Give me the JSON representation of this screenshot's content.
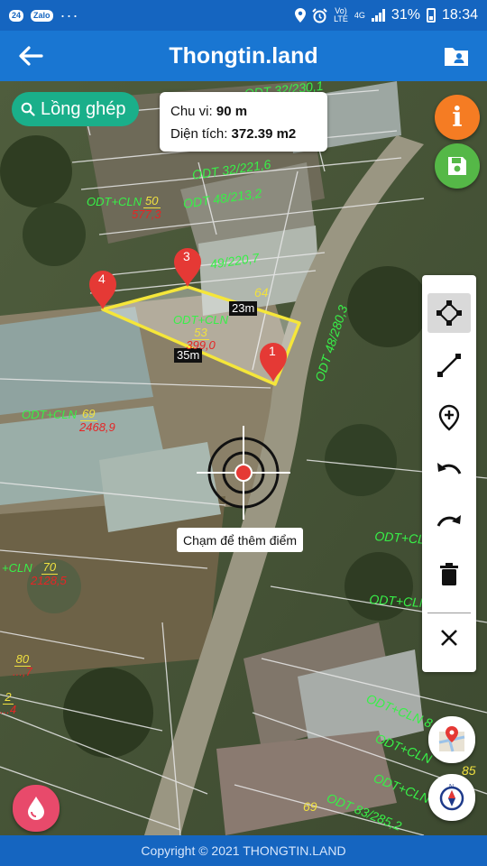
{
  "status_bar": {
    "time": "18:34",
    "battery": "31%",
    "network_top": "Vo)",
    "network_bottom": "LTE",
    "net_gen": "4G",
    "app_chip_1": "24",
    "app_chip_2": "Zalo",
    "more": "···"
  },
  "header": {
    "title": "Thongtin.land"
  },
  "search_chip": {
    "label": "Lồng ghép"
  },
  "info_card": {
    "perimeter_label": "Chu vi:",
    "perimeter_value": "90 m",
    "area_label": "Diện tích:",
    "area_value": "372.39 m2"
  },
  "map": {
    "hint": "Chạm để thêm điểm",
    "dimensions": {
      "top": "23m",
      "bottom": "35m"
    },
    "markers": [
      "1",
      "3",
      "4"
    ],
    "selected_parcel": {
      "type": "ODT+CLN",
      "number": "53",
      "area": "399,0"
    },
    "parcels": [
      {
        "type": "ODT+CLN",
        "number": "50",
        "area": "577,3"
      },
      {
        "type": "ODT+CLN",
        "number": "69",
        "area": "2468,9"
      },
      {
        "type": "+CLN",
        "number": "70",
        "area": "2128,5"
      },
      {
        "type": "",
        "number": "80",
        "area": "...,7"
      },
      {
        "type": "",
        "number": "2",
        "area": "...4"
      }
    ],
    "labels_green": [
      "ODT 32/230,1",
      "ODT 32/221,6",
      "ODT 48/213,2",
      "49/220,7",
      "ODT 48/280,3",
      "ODT+CLN",
      "ODT+CLN",
      "ODT+CLN 8",
      "ODT+CLN",
      "ODT+CLN",
      "ODT 83/285,2"
    ],
    "labels_yellow": [
      "64",
      "85",
      "69"
    ]
  },
  "toolbar": {
    "tools": [
      "select-polygon",
      "measure-line",
      "add-location",
      "undo",
      "redo",
      "delete",
      "close"
    ]
  },
  "footer": {
    "copyright": "Copyright © 2021 THONGTIN.LAND"
  },
  "colors": {
    "primary": "#1976d2",
    "status_bar": "#1565c0",
    "chip": "#1aaf8a",
    "info_fab": "#f57c23",
    "save_fab": "#55b847",
    "marker": "#e53935",
    "parcel_outline": "#f5e63a"
  }
}
